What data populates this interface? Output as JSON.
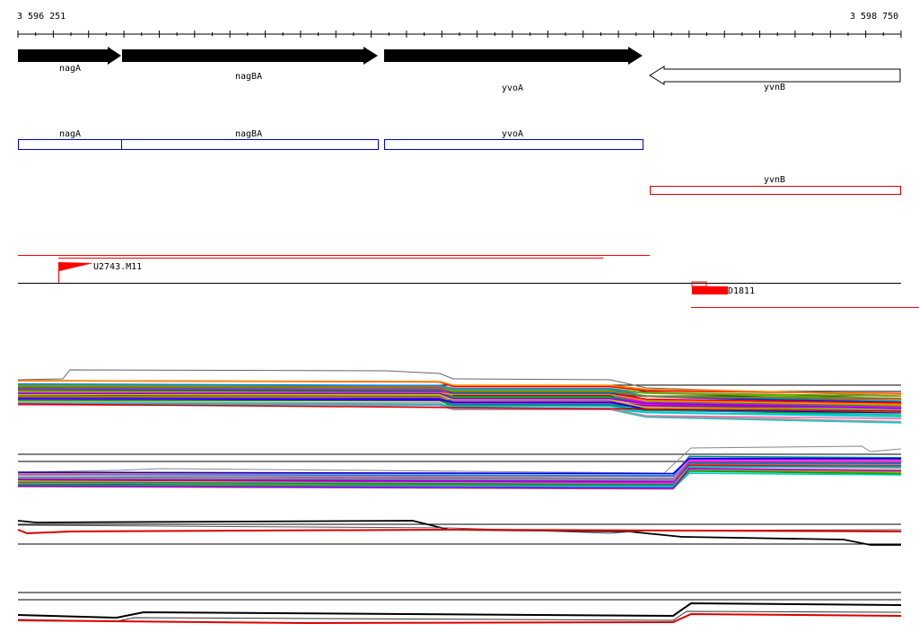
{
  "coords": {
    "start": "3 596 251",
    "end": "3 598 750"
  },
  "genes": [
    {
      "name": "nagA",
      "strand": "+"
    },
    {
      "name": "nagBA",
      "strand": "+"
    },
    {
      "name": "yvoA",
      "strand": "+"
    },
    {
      "name": "yvnB",
      "strand": "-"
    }
  ],
  "promoters": [
    {
      "name": "U2743.M11"
    }
  ],
  "terminators": [
    {
      "name": "D1811"
    }
  ],
  "colors": {
    "gene_fill": "#000000",
    "operon_outline": "#0000cc",
    "reverse_outline": "#dd0000",
    "feature_red": "#ff0000",
    "axis": "#000000"
  },
  "profile_panels": [
    {
      "kind": "multi-color",
      "count": 4
    }
  ]
}
